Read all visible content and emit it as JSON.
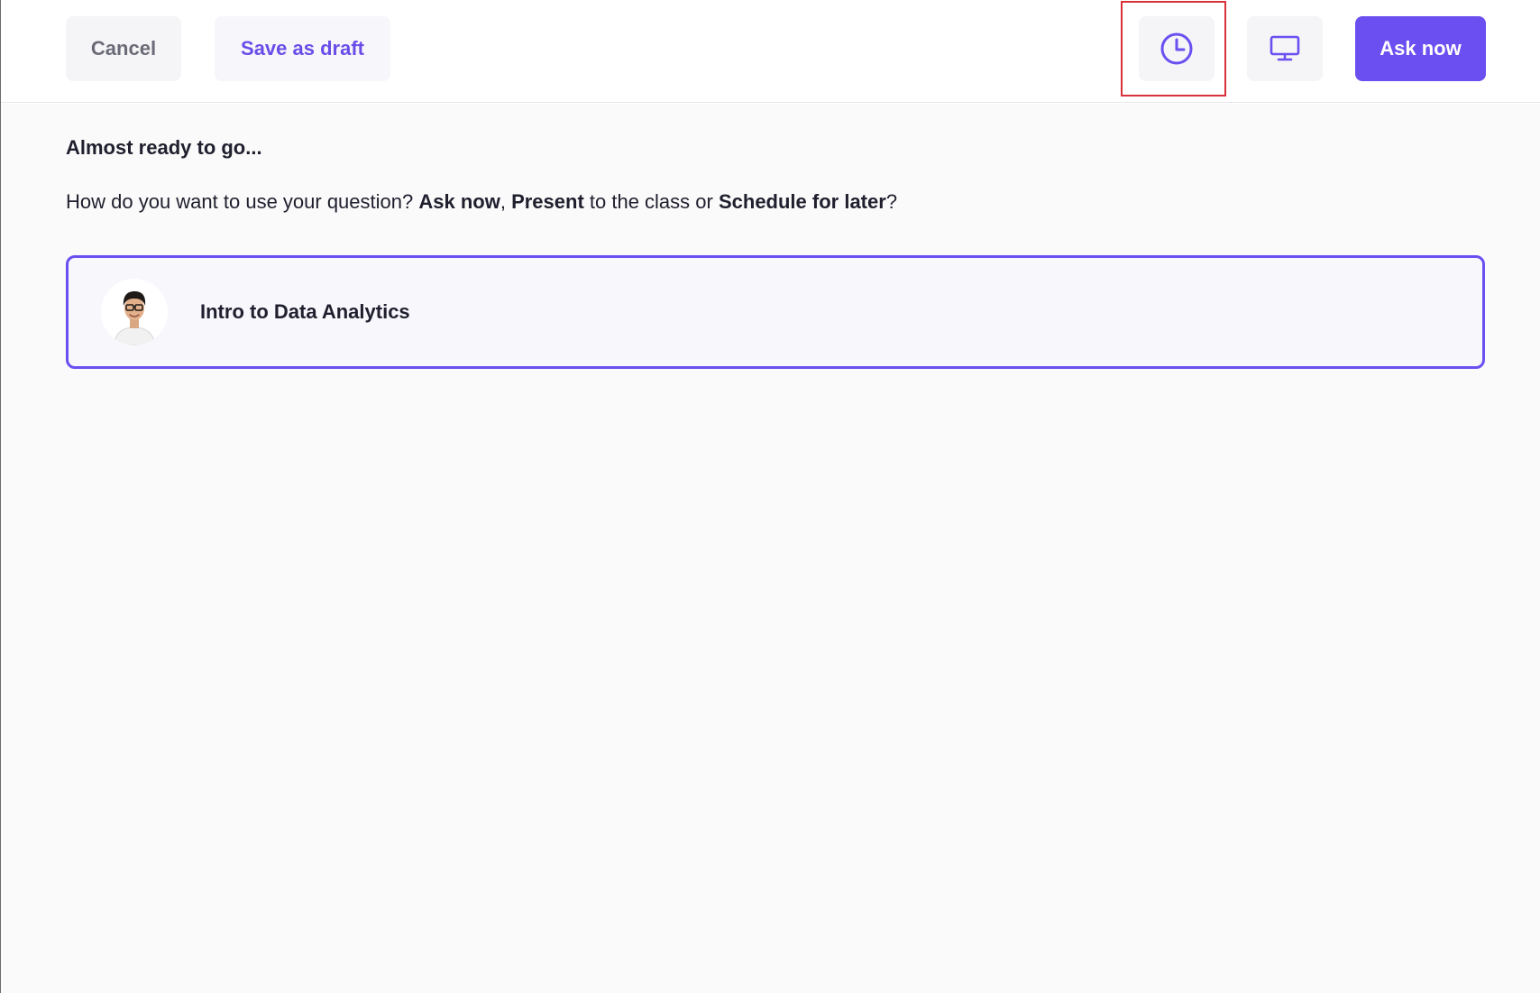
{
  "toolbar": {
    "cancel_label": "Cancel",
    "save_draft_label": "Save as draft",
    "schedule_icon": "clock-icon",
    "present_icon": "monitor-icon",
    "ask_now_label": "Ask now"
  },
  "main": {
    "heading": "Almost ready to go...",
    "question": {
      "part1": "How do you want to use your question? ",
      "ask_now": "Ask now",
      "sep1": ", ",
      "present": "Present",
      "part2": " to the class or ",
      "schedule": "Schedule for later",
      "end": "?"
    },
    "class_card": {
      "name": "Intro to Data Analytics"
    }
  },
  "colors": {
    "accent": "#6b4ff0",
    "highlight": "#d9303a"
  }
}
